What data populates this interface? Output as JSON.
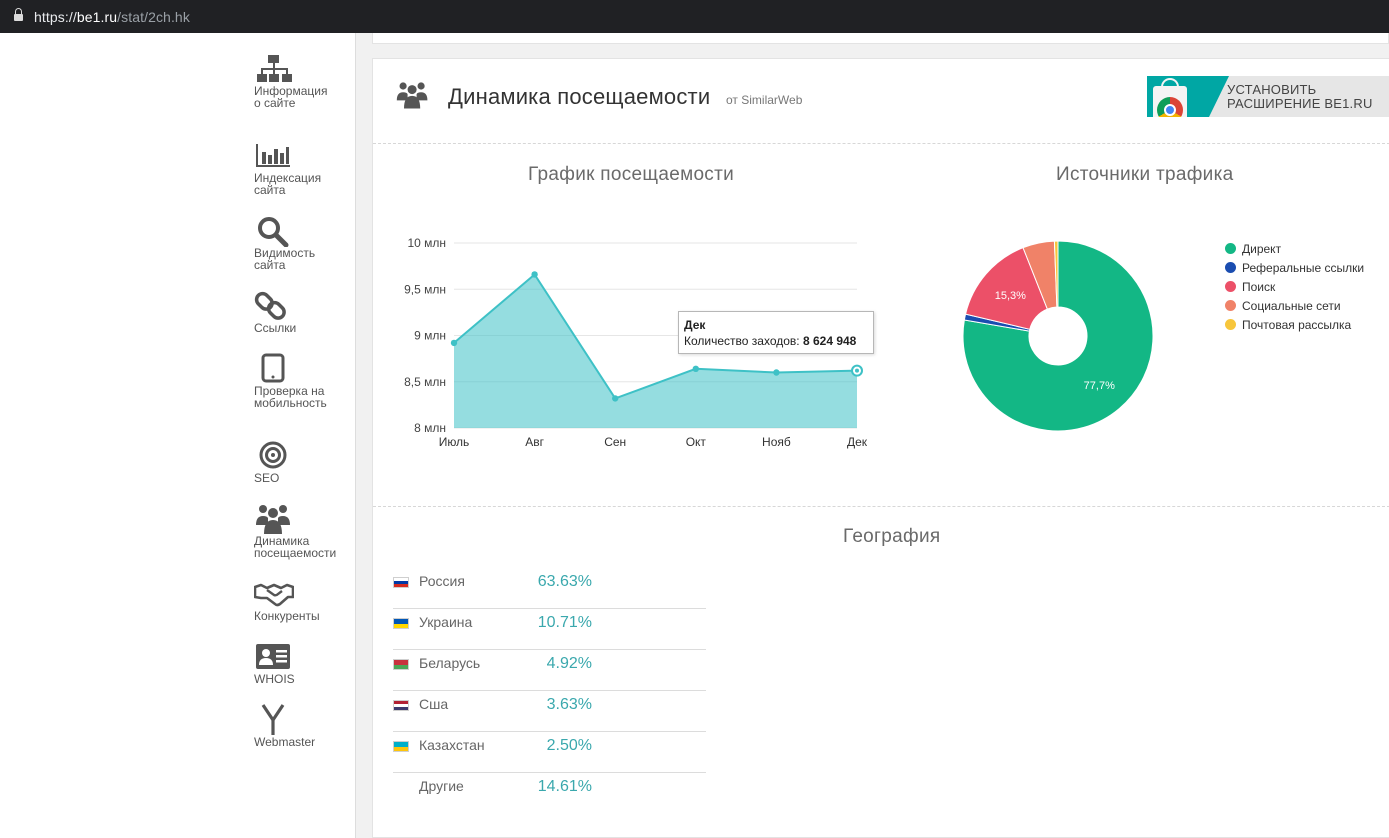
{
  "browser": {
    "scheme": "https://",
    "host": "be1.ru",
    "path": "/stat/2ch.hk"
  },
  "sidebar": {
    "items": [
      {
        "label": "Информация о сайте",
        "icon": "sitemap-icon"
      },
      {
        "label": "Индексация сайта",
        "icon": "bar-chart-icon"
      },
      {
        "label": "Видимость сайта",
        "icon": "search-icon"
      },
      {
        "label": "Ссылки",
        "icon": "link-icon"
      },
      {
        "label": "Проверка на мобильность",
        "icon": "tablet-icon"
      },
      {
        "label": "SEO",
        "icon": "target-icon"
      },
      {
        "label": "Динамика посещаемости",
        "icon": "users-icon"
      },
      {
        "label": "Конкуренты",
        "icon": "handshake-icon"
      },
      {
        "label": "WHOIS",
        "icon": "id-card-icon"
      },
      {
        "label": "Webmaster",
        "icon": "yandex-icon"
      }
    ]
  },
  "card": {
    "title": "Динамика посещаемости",
    "source": "от SimilarWeb",
    "extension_line1": "УСТАНОВИТЬ",
    "extension_line2": "РАСШИРЕНИЕ BE1.RU"
  },
  "traffic_chart": {
    "title": "График посещаемости",
    "tooltip": {
      "title": "Дек",
      "label": "Количество заходов:",
      "value": "8 624 948"
    }
  },
  "sources_chart": {
    "title": "Источники трафика"
  },
  "geography": {
    "title": "География",
    "rows": [
      {
        "country": "Россия",
        "value": "63.63%",
        "flag": [
          "#ffffff",
          "#0039a6",
          "#d52b1e"
        ]
      },
      {
        "country": "Украина",
        "value": "10.71%",
        "flag": [
          "#0057b7",
          "#ffd700"
        ]
      },
      {
        "country": "Беларусь",
        "value": "4.92%",
        "flag": [
          "#c8313e",
          "#4aa657"
        ]
      },
      {
        "country": "Сша",
        "value": "3.63%",
        "flag": [
          "#b22234",
          "#ffffff",
          "#3c3b6e"
        ]
      },
      {
        "country": "Казахстан",
        "value": "2.50%",
        "flag": [
          "#00afca",
          "#fec50c"
        ]
      },
      {
        "country": "Другие",
        "value": "14.61%",
        "flag": []
      }
    ]
  },
  "chart_data": [
    {
      "type": "area",
      "title": "График посещаемости",
      "categories": [
        "Июль",
        "Авг",
        "Сен",
        "Окт",
        "Нояб",
        "Дек"
      ],
      "values": [
        8.92,
        9.66,
        8.32,
        8.64,
        8.6,
        8.62
      ],
      "y_ticks": [
        "8 млн",
        "8,5 млн",
        "9 млн",
        "9,5 млн",
        "10 млн"
      ],
      "ylim": [
        8,
        10
      ],
      "grid": true,
      "color": "#3ec1c6"
    },
    {
      "type": "pie",
      "title": "Источники трафика",
      "donut": true,
      "slices": [
        {
          "name": "Директ",
          "value": 77.7,
          "color": "#13b785",
          "label": "77,7%"
        },
        {
          "name": "Реферальные ссылки",
          "value": 1.0,
          "color": "#1a4db0",
          "label": ""
        },
        {
          "name": "Поиск",
          "value": 15.3,
          "color": "#ec5068",
          "label": "15,3%"
        },
        {
          "name": "Социальные сети",
          "value": 5.4,
          "color": "#f08268",
          "label": ""
        },
        {
          "name": "Почтовая рассылка",
          "value": 0.6,
          "color": "#f7c63c",
          "label": ""
        }
      ],
      "legend_position": "right"
    }
  ]
}
